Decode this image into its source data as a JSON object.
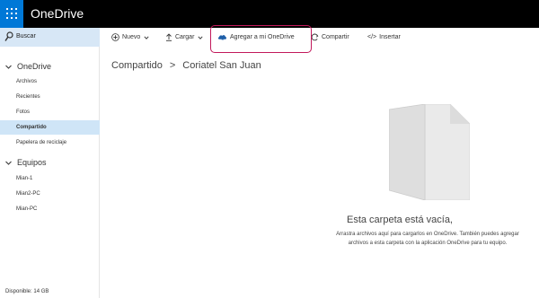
{
  "app": {
    "title": "OneDrive"
  },
  "search": {
    "label": "Buscar"
  },
  "commands": {
    "new": "Nuevo",
    "upload": "Cargar",
    "add_to_onedrive": "Agregar a mi OneDrive",
    "share": "Compartir",
    "embed": "Insertar"
  },
  "sidebar": {
    "onedrive_heading": "OneDrive",
    "items": [
      "Archivos",
      "Recientes",
      "Fotos",
      "Compartido",
      "Papelera de reciclaje"
    ],
    "active_item": "Compartido",
    "devices_heading": "Equipos",
    "devices": [
      "Mian-1",
      "Mian2-PC",
      "Mian-PC"
    ],
    "quota": "Disponible: 14 GB"
  },
  "breadcrumb": {
    "root": "Compartido",
    "separator": ">",
    "current": "Coriatel San Juan"
  },
  "empty_state": {
    "title": "Esta carpeta está vacía,",
    "description": "Arrastra archivos aquí para cargarlos en OneDrive. También puedes agregar archivos a esta carpeta con la aplicación OneDrive para tu equipo."
  },
  "colors": {
    "appbar": "#000000",
    "waffle": "#0078d7",
    "search_bg": "#d7e7f6",
    "active_nav": "#cfe5f7",
    "highlight": "#c2185b",
    "folder": "#e6e6e6"
  },
  "icons": [
    "waffle-icon",
    "search-icon",
    "plus-icon",
    "upload-icon",
    "cloud-icon",
    "share-icon",
    "embed-icon",
    "chevron-down-icon",
    "folder-icon"
  ]
}
